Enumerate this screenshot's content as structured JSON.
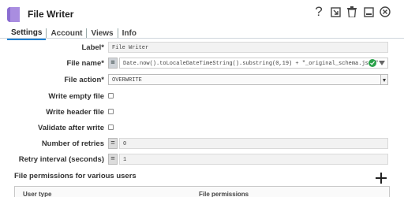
{
  "header": {
    "title": "File Writer",
    "icons": [
      "help-icon",
      "export-icon",
      "trash-icon",
      "minimize-icon",
      "close-icon"
    ]
  },
  "tabs": [
    {
      "label": "Settings",
      "active": true
    },
    {
      "label": "Account",
      "active": false
    },
    {
      "label": "Views",
      "active": false
    },
    {
      "label": "Info",
      "active": false
    }
  ],
  "form": {
    "label": {
      "label": "Label*",
      "value": "File Writer"
    },
    "file_name": {
      "label": "File name*",
      "value": "Date.now().toLocaleDateTimeString().substring(0,19) + \"_original_schema.json\"",
      "expr_button": "="
    },
    "file_action": {
      "label": "File action*",
      "value": "OVERWRITE"
    },
    "write_empty_file": {
      "label": "Write empty file",
      "checked": false
    },
    "write_header_file": {
      "label": "Write header file",
      "checked": false
    },
    "validate_after_write": {
      "label": "Validate after write",
      "checked": false
    },
    "number_of_retries": {
      "label": "Number of retries",
      "value": "0",
      "expr_button": "="
    },
    "retry_interval": {
      "label": "Retry interval (seconds)",
      "value": "1",
      "expr_button": "="
    }
  },
  "permissions": {
    "title": "File permissions for various users",
    "columns": [
      "User type",
      "File permissions"
    ]
  },
  "colors": {
    "accent": "#1f7fd0",
    "snap_icon": "#a98de0",
    "valid": "#2aa24a"
  }
}
